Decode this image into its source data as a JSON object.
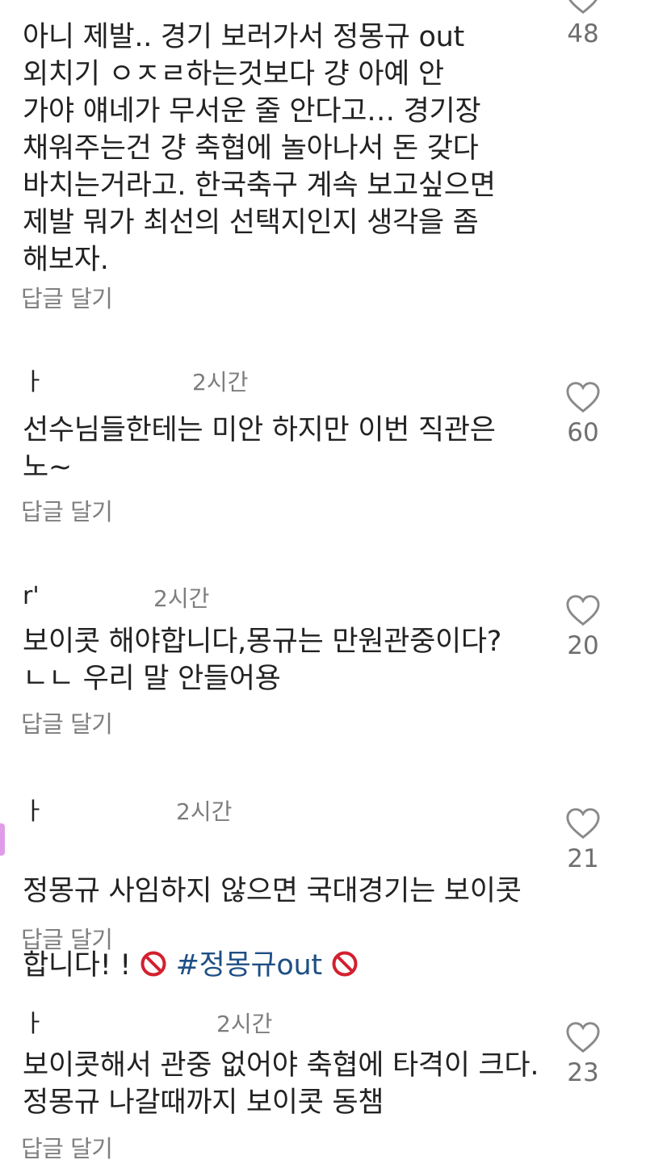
{
  "reply_label": "답글 달기",
  "comments": [
    {
      "username": "",
      "time": "",
      "lines": "아니 제발.. 경기 보러가서 정몽규 out\n외치기 ㅇㅈㄹ하는것보다 걍 아예 안\n가야 얘네가 무서운 줄 안다고… 경기장\n채워주는건 걍 축협에 놀아나서 돈 갖다\n바치는거라고. 한국축구 계속 보고싶으면\n제발 뭐가 최선의 선택지인지 생각을 좀\n해보자.",
      "likes": "48",
      "reply": "답글 달기"
    },
    {
      "username": "ㅏ",
      "time": "2시간",
      "lines": "선수님들한테는 미안 하지만 이번 직관은\n노~",
      "likes": "60",
      "reply": "답글 달기"
    },
    {
      "username": "r'",
      "time": "2시간",
      "lines": "보이콧 해야합니다,몽규는 만원관중이다?\nㄴㄴ 우리 말 안들어용",
      "likes": "20",
      "reply": "답글 달기"
    },
    {
      "username": "ㅏ",
      "time": "2시간",
      "text_line1": "정몽규 사임하지 않으면 국대경기는 보이콧",
      "text_line2_prefix": "합니다! ! ",
      "hashtag": "#정몽규out",
      "likes": "21",
      "reply": "답글 달기"
    },
    {
      "username": "ㅏ",
      "time": "2시간",
      "lines": "보이콧해서 관중 없어야 축협에 타격이 크다.\n정몽규 나갈때까지  보이콧 동챔",
      "likes": "23",
      "reply": "답글 달기"
    }
  ],
  "icons": {
    "like": "heart-outline-icon",
    "prohibited": "prohibited-icon"
  },
  "colors": {
    "text": "#222222",
    "muted": "#7d7d7d",
    "hashtag": "#1f4f85",
    "prohibited": "#d3202f"
  }
}
